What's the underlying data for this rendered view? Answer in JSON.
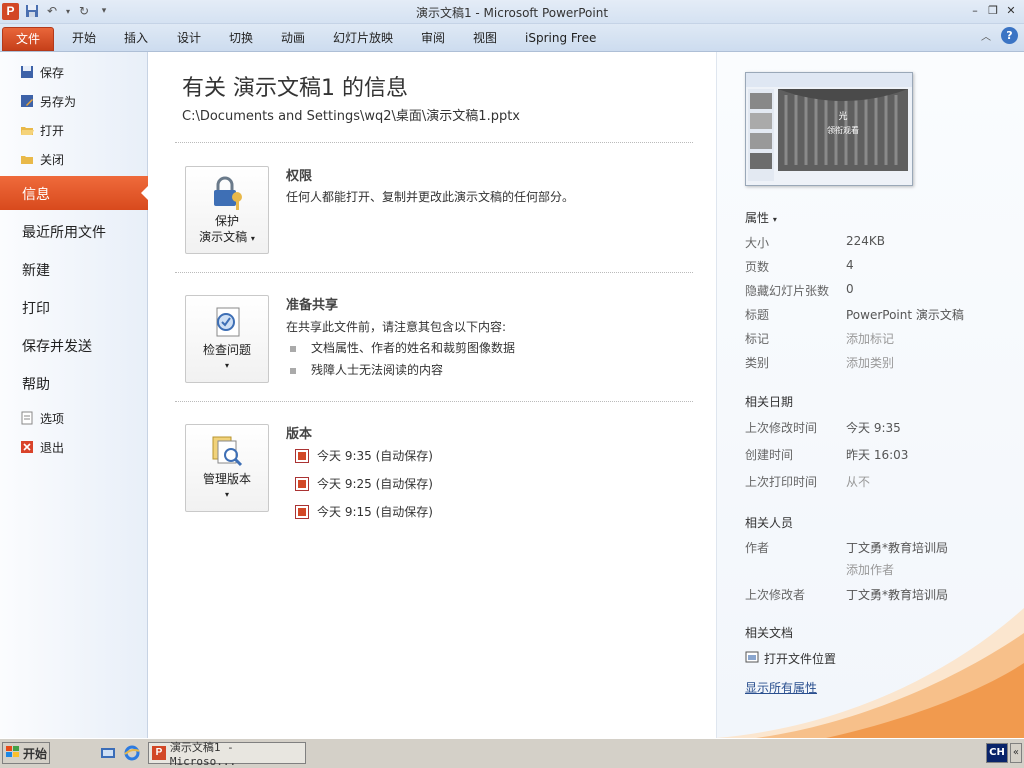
{
  "window": {
    "title": "演示文稿1 - Microsoft PowerPoint"
  },
  "ribbon": {
    "tabs": [
      "文件",
      "开始",
      "插入",
      "设计",
      "切换",
      "动画",
      "幻灯片放映",
      "审阅",
      "视图",
      "iSpring Free"
    ]
  },
  "leftnav": {
    "small_items": [
      "保存",
      "另存为",
      "打开",
      "关闭"
    ],
    "active": "信息",
    "big_items": [
      "最近所用文件",
      "新建",
      "打印",
      "保存并发送",
      "帮助"
    ],
    "bottom_items": [
      "选项",
      "退出"
    ]
  },
  "info": {
    "title": "有关 演示文稿1 的信息",
    "path": "C:\\Documents and Settings\\wq2\\桌面\\演示文稿1.pptx",
    "permissions": {
      "button_line1": "保护",
      "button_line2": "演示文稿",
      "title": "权限",
      "desc": "任何人都能打开、复制并更改此演示文稿的任何部分。"
    },
    "prepare": {
      "button_label": "检查问题",
      "title": "准备共享",
      "desc": "在共享此文件前，请注意其包含以下内容:",
      "bullets": [
        "文档属性、作者的姓名和裁剪图像数据",
        "残障人士无法阅读的内容"
      ]
    },
    "versions": {
      "button_label": "管理版本",
      "title": "版本",
      "items": [
        "今天 9:35 (自动保存)",
        "今天 9:25 (自动保存)",
        "今天 9:15 (自动保存)"
      ]
    }
  },
  "properties": {
    "header": "属性",
    "rows": [
      {
        "key": "大小",
        "value": "224KB"
      },
      {
        "key": "页数",
        "value": "4"
      },
      {
        "key": "隐藏幻灯片张数",
        "value": "0"
      },
      {
        "key": "标题",
        "value": "PowerPoint 演示文稿"
      },
      {
        "key": "标记",
        "value": "添加标记"
      },
      {
        "key": "类别",
        "value": "添加类别"
      }
    ],
    "dates_header": "相关日期",
    "dates": [
      {
        "key": "上次修改时间",
        "value": "今天 9:35"
      },
      {
        "key": "创建时间",
        "value": "昨天 16:03"
      },
      {
        "key": "上次打印时间",
        "value": "从不"
      }
    ],
    "people_header": "相关人员",
    "author_key": "作者",
    "author_value": "丁文勇*教育培训局",
    "add_author": "添加作者",
    "modifier_key": "上次修改者",
    "modifier_value": "丁文勇*教育培训局",
    "docs_header": "相关文档",
    "open_location": "打开文件位置",
    "show_all": "显示所有属性",
    "thumb_text_1": "光",
    "thumb_text_2": "领衔观看"
  },
  "taskbar": {
    "start": "开始",
    "task": "演示文稿1 - Microso...",
    "ime": "CH",
    "arrow": "«"
  },
  "colors": {
    "accent": "#d84a1d",
    "ribbon": "#dfe9f5",
    "link": "#2a4f8f"
  }
}
